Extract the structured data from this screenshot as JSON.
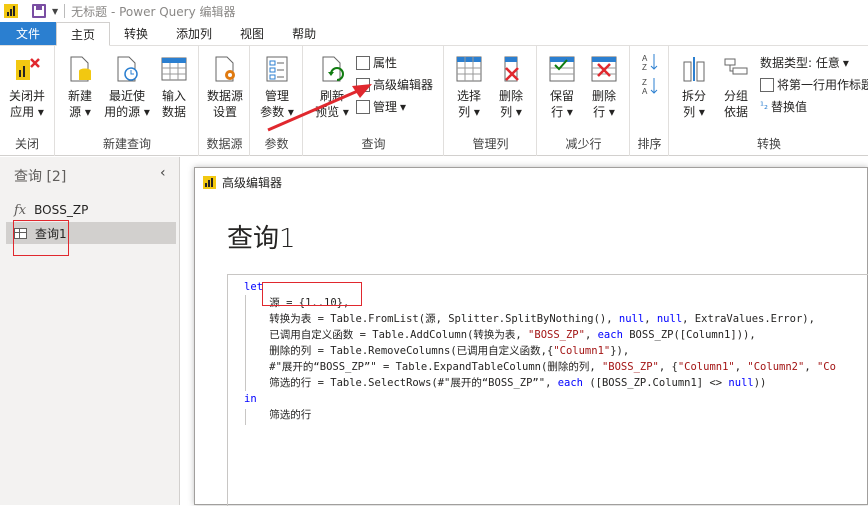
{
  "window": {
    "title": "无标题 - Power Query 编辑器"
  },
  "tabs": [
    {
      "label": "文件"
    },
    {
      "label": "主页"
    },
    {
      "label": "转换"
    },
    {
      "label": "添加列"
    },
    {
      "label": "视图"
    },
    {
      "label": "帮助"
    }
  ],
  "ribbon": {
    "close": {
      "btn1": "关闭并",
      "btn1b": "应用",
      "group": "关闭"
    },
    "newquery": {
      "new1": "新建",
      "new2": "源",
      "recent1": "最近使",
      "recent2": "用的源",
      "enter1": "输入",
      "enter2": "数据",
      "group": "新建查询"
    },
    "datasource": {
      "l1": "数据源",
      "l2": "设置",
      "group": "数据源"
    },
    "params": {
      "l1": "管理",
      "l2": "参数",
      "group": "参数"
    },
    "query": {
      "refresh1": "刷新",
      "refresh2": "预览",
      "props": "属性",
      "advanced": "高级编辑器",
      "manage": "管理",
      "group": "查询"
    },
    "managecols": {
      "choose1": "选择",
      "choose2": "列",
      "remove1": "删除",
      "remove2": "列",
      "group": "管理列"
    },
    "reducerows": {
      "keep1": "保留",
      "keep2": "行",
      "remove1": "删除",
      "remove2": "行",
      "group": "减少行"
    },
    "sort": {
      "group": "排序"
    },
    "transform": {
      "split1": "拆分",
      "split2": "列",
      "group1": "分组",
      "group2": "依据",
      "datatype": "数据类型: 任意",
      "firstrow": "将第一行用作标题",
      "replace": "替换值",
      "group": "转换"
    }
  },
  "queries_pane": {
    "title": "查询 [2]",
    "items": [
      {
        "label": "BOSS_ZP"
      },
      {
        "label": "查询1"
      }
    ]
  },
  "dialog": {
    "title": "高级编辑器",
    "heading": "查询1"
  },
  "colors": {
    "accent": "#2b7fd0",
    "annotation": "#e0282e",
    "keyword": "#0000ff",
    "string": "#a31515"
  }
}
